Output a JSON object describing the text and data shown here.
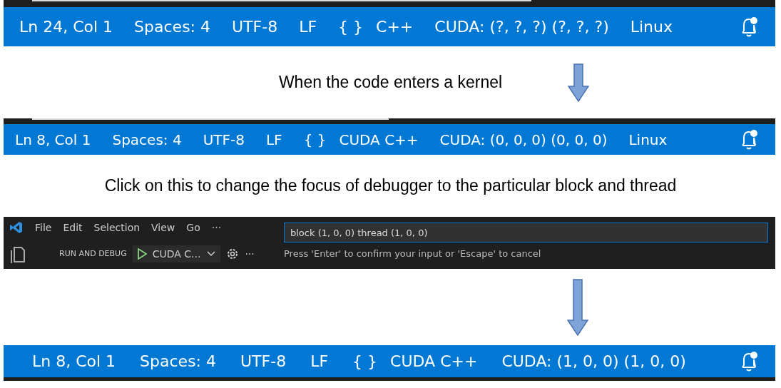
{
  "status_bars": [
    {
      "items": [
        {
          "kind": "text",
          "text": "Ln 24, Col 1"
        },
        {
          "kind": "text",
          "text": "Spaces: 4"
        },
        {
          "kind": "text",
          "text": "UTF-8"
        },
        {
          "kind": "text",
          "text": "LF"
        },
        {
          "kind": "language",
          "braces": "{ }",
          "text": "C++"
        },
        {
          "kind": "text",
          "text": "CUDA: (?, ?, ?) (?, ?, ?)"
        },
        {
          "kind": "text",
          "text": "Linux"
        }
      ]
    },
    {
      "items": [
        {
          "kind": "text",
          "text": "Ln 8, Col 1"
        },
        {
          "kind": "text",
          "text": "Spaces: 4"
        },
        {
          "kind": "text",
          "text": "UTF-8"
        },
        {
          "kind": "text",
          "text": "LF"
        },
        {
          "kind": "language",
          "braces": "{ }",
          "text": "CUDA C++"
        },
        {
          "kind": "text",
          "text": "CUDA: (0, 0, 0) (0, 0, 0)"
        },
        {
          "kind": "text",
          "text": "Linux"
        }
      ]
    },
    {
      "items": [
        {
          "kind": "text",
          "text": "Ln 8, Col 1"
        },
        {
          "kind": "text",
          "text": "Spaces: 4"
        },
        {
          "kind": "text",
          "text": "UTF-8"
        },
        {
          "kind": "text",
          "text": "LF"
        },
        {
          "kind": "language",
          "braces": "{ }",
          "text": "CUDA C++"
        },
        {
          "kind": "text",
          "text": "CUDA: (1, 0, 0) (1, 0, 0)"
        }
      ]
    }
  ],
  "captions": [
    "When the code enters a kernel",
    "Click on this to change the focus of debugger to the particular block and thread"
  ],
  "editor": {
    "menu": [
      "File",
      "Edit",
      "Selection",
      "View",
      "Go",
      "···"
    ],
    "input": {
      "value": "block (1, 0, 0) thread (1, 0, 0)",
      "hint": "Press 'Enter' to confirm your input or 'Escape' to cancel"
    },
    "run_title": "RUN AND DEBUG",
    "configuration": "CUDA C...",
    "more": "···"
  }
}
